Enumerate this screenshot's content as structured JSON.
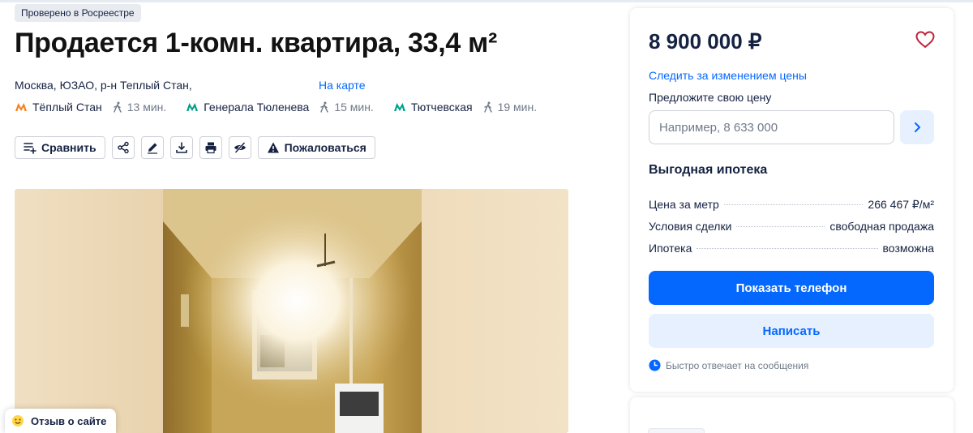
{
  "badge": "Проверено в Росреестре",
  "title": "Продается 1-комн. квартира, 33,4 м²",
  "address": "Москва, ЮЗАО, р-н Теплый Стан,",
  "map_link": "На карте",
  "metro": [
    {
      "name": "Тёплый Стан",
      "time": "13 мин.",
      "color": "#f58220"
    },
    {
      "name": "Генерала Тюленева",
      "time": "15 мин.",
      "color": "#00a08a"
    },
    {
      "name": "Тютчевская",
      "time": "19 мин.",
      "color": "#00a08a"
    }
  ],
  "toolbar": {
    "compare_label": "Сравнить",
    "complain_label": "Пожаловаться",
    "icons": [
      "compare-icon",
      "share-icon",
      "edit-icon",
      "download-icon",
      "print-icon",
      "hide-icon",
      "warning-icon"
    ]
  },
  "feedback_label": "Отзыв о сайте",
  "sidebar": {
    "price": "8 900 000 ₽",
    "follow_price": "Следить за изменением цены",
    "offer_label": "Предложите свою цену",
    "offer_placeholder": "Например, 8 633 000",
    "mortgage_title": "Выгодная ипотека",
    "facts": [
      {
        "key": "Цена за метр",
        "value": "266 467 ₽/м²"
      },
      {
        "key": "Условия сделки",
        "value": "свободная продажа"
      },
      {
        "key": "Ипотека",
        "value": "возможна"
      }
    ],
    "show_phone": "Показать телефон",
    "write": "Написать",
    "reply_note": "Быстро отвечает на сообщения"
  },
  "colors": {
    "accent": "#0468ff",
    "accent_light": "#e6f0ff",
    "text": "#152242",
    "muted": "#707a89",
    "favorite": "#c0223a"
  }
}
